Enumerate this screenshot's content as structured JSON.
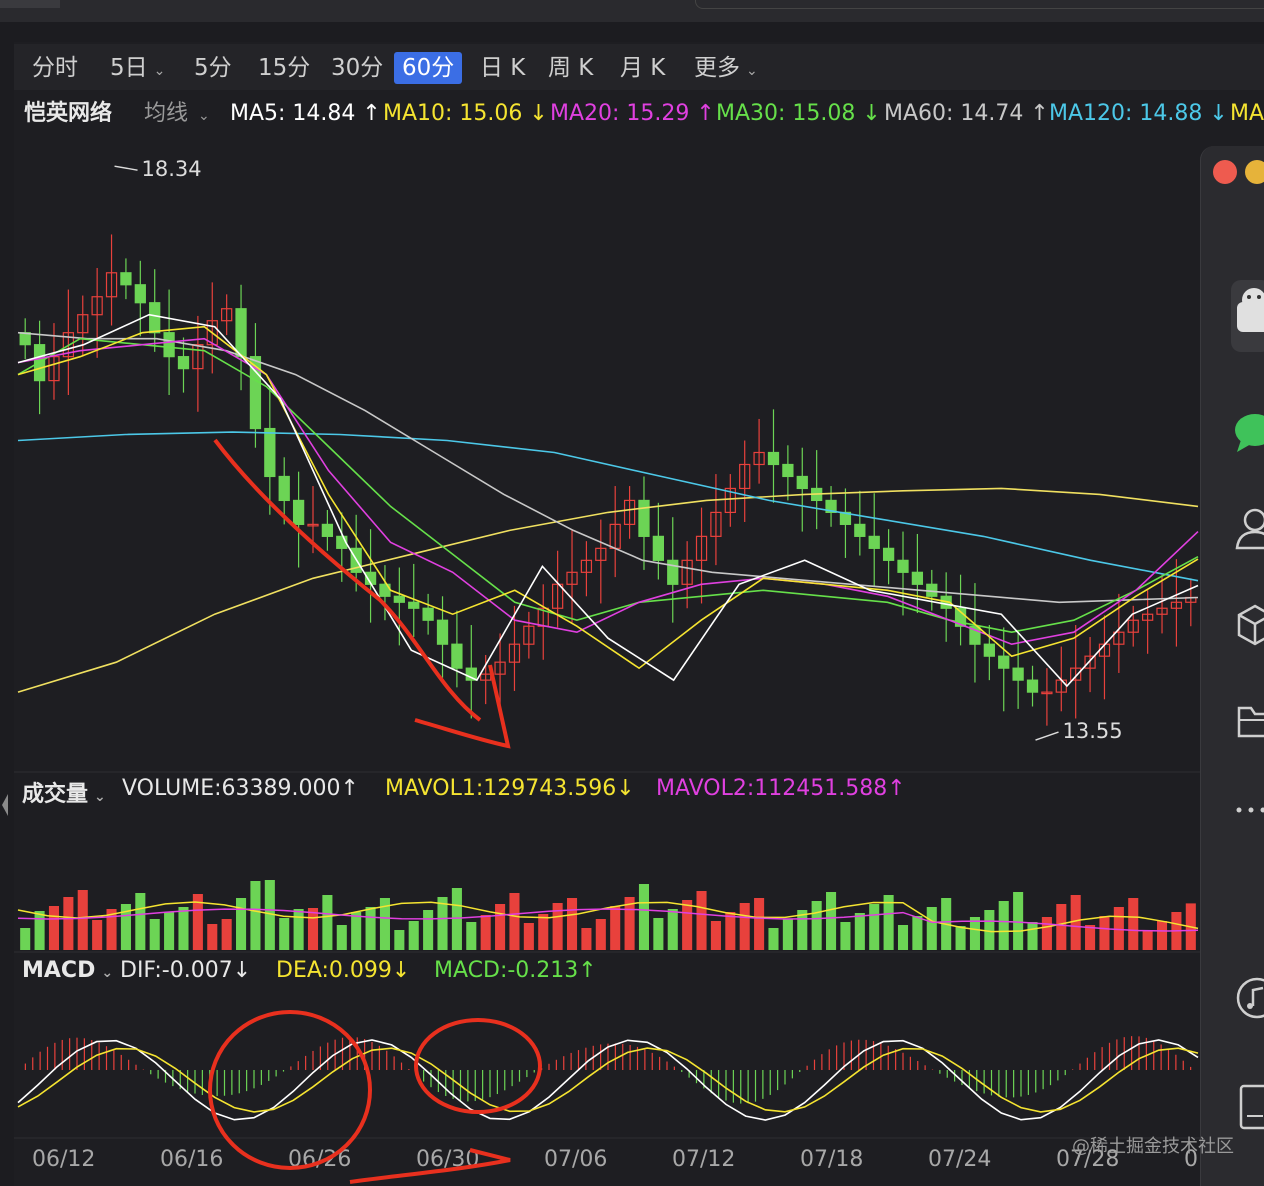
{
  "tabs": [
    {
      "label": "分时",
      "active": false,
      "dropdown": false
    },
    {
      "label": "5日",
      "active": false,
      "dropdown": true
    },
    {
      "label": "5分",
      "active": false,
      "dropdown": false
    },
    {
      "label": "15分",
      "active": false,
      "dropdown": false
    },
    {
      "label": "30分",
      "active": false,
      "dropdown": false
    },
    {
      "label": "60分",
      "active": true,
      "dropdown": false
    },
    {
      "label": "日 K",
      "active": false,
      "dropdown": false
    },
    {
      "label": "周 K",
      "active": false,
      "dropdown": false
    },
    {
      "label": "月 K",
      "active": false,
      "dropdown": false
    },
    {
      "label": "更多",
      "active": false,
      "dropdown": true
    }
  ],
  "stock": {
    "name": "恺英网络",
    "indicator": "均线"
  },
  "ma": [
    {
      "text": "MA5: 14.84 ↑",
      "color": "#ffffff"
    },
    {
      "text": "MA10: 15.06 ↓",
      "color": "#f5e431"
    },
    {
      "text": "MA20: 15.29 ↑",
      "color": "#e040e0"
    },
    {
      "text": "MA30: 15.08 ↓",
      "color": "#66e04a"
    },
    {
      "text": "MA60: 14.74 ↑",
      "color": "#c8c8c8"
    },
    {
      "text": "MA120: 14.88 ↓",
      "color": "#4cc8e8"
    },
    {
      "text": "MA",
      "color": "#f5e431"
    }
  ],
  "volume_header": {
    "label": "成交量",
    "volume": "VOLUME:63389.000↑",
    "mavol1": "MAVOL1:129743.596↓",
    "mavol2": "MAVOL2:112451.588↑"
  },
  "macd_header": {
    "label": "MACD",
    "dif": "DIF:-0.007↓",
    "dea": "DEA:0.099↓",
    "macd": "MACD:-0.213↑"
  },
  "annotations": {
    "high": "18.34",
    "low": "13.55"
  },
  "watermark": "@稀土掘金技术社区",
  "colors": {
    "up": "#e8413c",
    "down": "#6cd455",
    "ma5": "#ffffff",
    "ma10": "#f5e431",
    "ma20": "#e040e0",
    "ma30": "#66e04a",
    "ma60": "#c8c8c8",
    "ma120": "#4cc8e8",
    "ma250": "#f0e060",
    "mavol1": "#f5e431",
    "mavol2": "#e040e0",
    "dif": "#ffffff",
    "dea": "#f5e431",
    "markup": "#e8301e",
    "accent": "#3b6ee5"
  },
  "chart_data": {
    "type": "candlestick",
    "x_tick_labels": [
      "06/12",
      "06/16",
      "06/26",
      "06/30",
      "07/06",
      "07/12",
      "07/18",
      "07/24",
      "07/28",
      "0"
    ],
    "price_high": 18.34,
    "price_low": 13.55,
    "ylim": [
      13.3,
      18.6
    ],
    "close": [
      16.85,
      16.55,
      16.75,
      16.95,
      17.1,
      17.25,
      17.45,
      17.35,
      17.2,
      16.95,
      16.75,
      16.65,
      16.85,
      17.05,
      17.15,
      16.75,
      16.15,
      15.75,
      15.55,
      15.35,
      15.35,
      15.25,
      15.15,
      14.95,
      14.85,
      14.75,
      14.7,
      14.65,
      14.55,
      14.35,
      14.15,
      14.05,
      14.1,
      14.2,
      14.35,
      14.5,
      14.65,
      14.85,
      14.95,
      15.05,
      15.15,
      15.35,
      15.55,
      15.25,
      15.05,
      14.85,
      15.05,
      15.25,
      15.45,
      15.65,
      15.85,
      15.95,
      15.85,
      15.75,
      15.65,
      15.55,
      15.45,
      15.35,
      15.25,
      15.15,
      15.05,
      14.95,
      14.85,
      14.75,
      14.65,
      14.5,
      14.35,
      14.25,
      14.15,
      14.05,
      13.95,
      13.95,
      14.05,
      14.15,
      14.25,
      14.35,
      14.45,
      14.55,
      14.6,
      14.65,
      14.7,
      14.74
    ],
    "ma_series": {
      "MA5": [
        16.7,
        16.85,
        17.1,
        17.0,
        16.4,
        15.2,
        14.3,
        14.05,
        15.0,
        14.4,
        14.05,
        14.85,
        15.05,
        14.8,
        14.7,
        14.6,
        14.0,
        14.6,
        14.84
      ],
      "MA10": [
        16.6,
        16.75,
        16.95,
        17.0,
        16.6,
        15.6,
        14.8,
        14.6,
        14.8,
        14.5,
        14.15,
        14.55,
        14.9,
        14.85,
        14.8,
        14.7,
        14.25,
        14.4,
        14.75,
        15.06
      ],
      "MA20": [
        16.7,
        16.8,
        16.85,
        16.9,
        16.6,
        15.8,
        15.2,
        14.95,
        14.55,
        14.45,
        14.7,
        14.85,
        14.9,
        14.85,
        14.75,
        14.55,
        14.35,
        14.45,
        14.8,
        15.29
      ],
      "MA30": [
        16.6,
        16.9,
        16.85,
        16.8,
        16.5,
        16.0,
        15.5,
        15.1,
        14.7,
        14.55,
        14.7,
        14.75,
        14.8,
        14.75,
        14.7,
        14.55,
        14.45,
        14.55,
        14.8,
        15.08
      ],
      "MA60": [
        16.95,
        16.9,
        16.9,
        16.8,
        16.6,
        16.3,
        15.95,
        15.6,
        15.3,
        15.05,
        14.95,
        14.9,
        14.85,
        14.8,
        14.75,
        14.7,
        14.72,
        14.74
      ],
      "MA120": [
        16.05,
        16.1,
        16.12,
        16.1,
        16.05,
        15.95,
        15.75,
        15.55,
        15.4,
        15.25,
        15.05,
        14.88
      ],
      "MA250": [
        13.95,
        14.2,
        14.6,
        14.9,
        15.1,
        15.3,
        15.45,
        15.55,
        15.6,
        15.63,
        15.65,
        15.6,
        15.5
      ]
    },
    "macd_dif_range": [
      -0.9,
      0.5
    ]
  }
}
